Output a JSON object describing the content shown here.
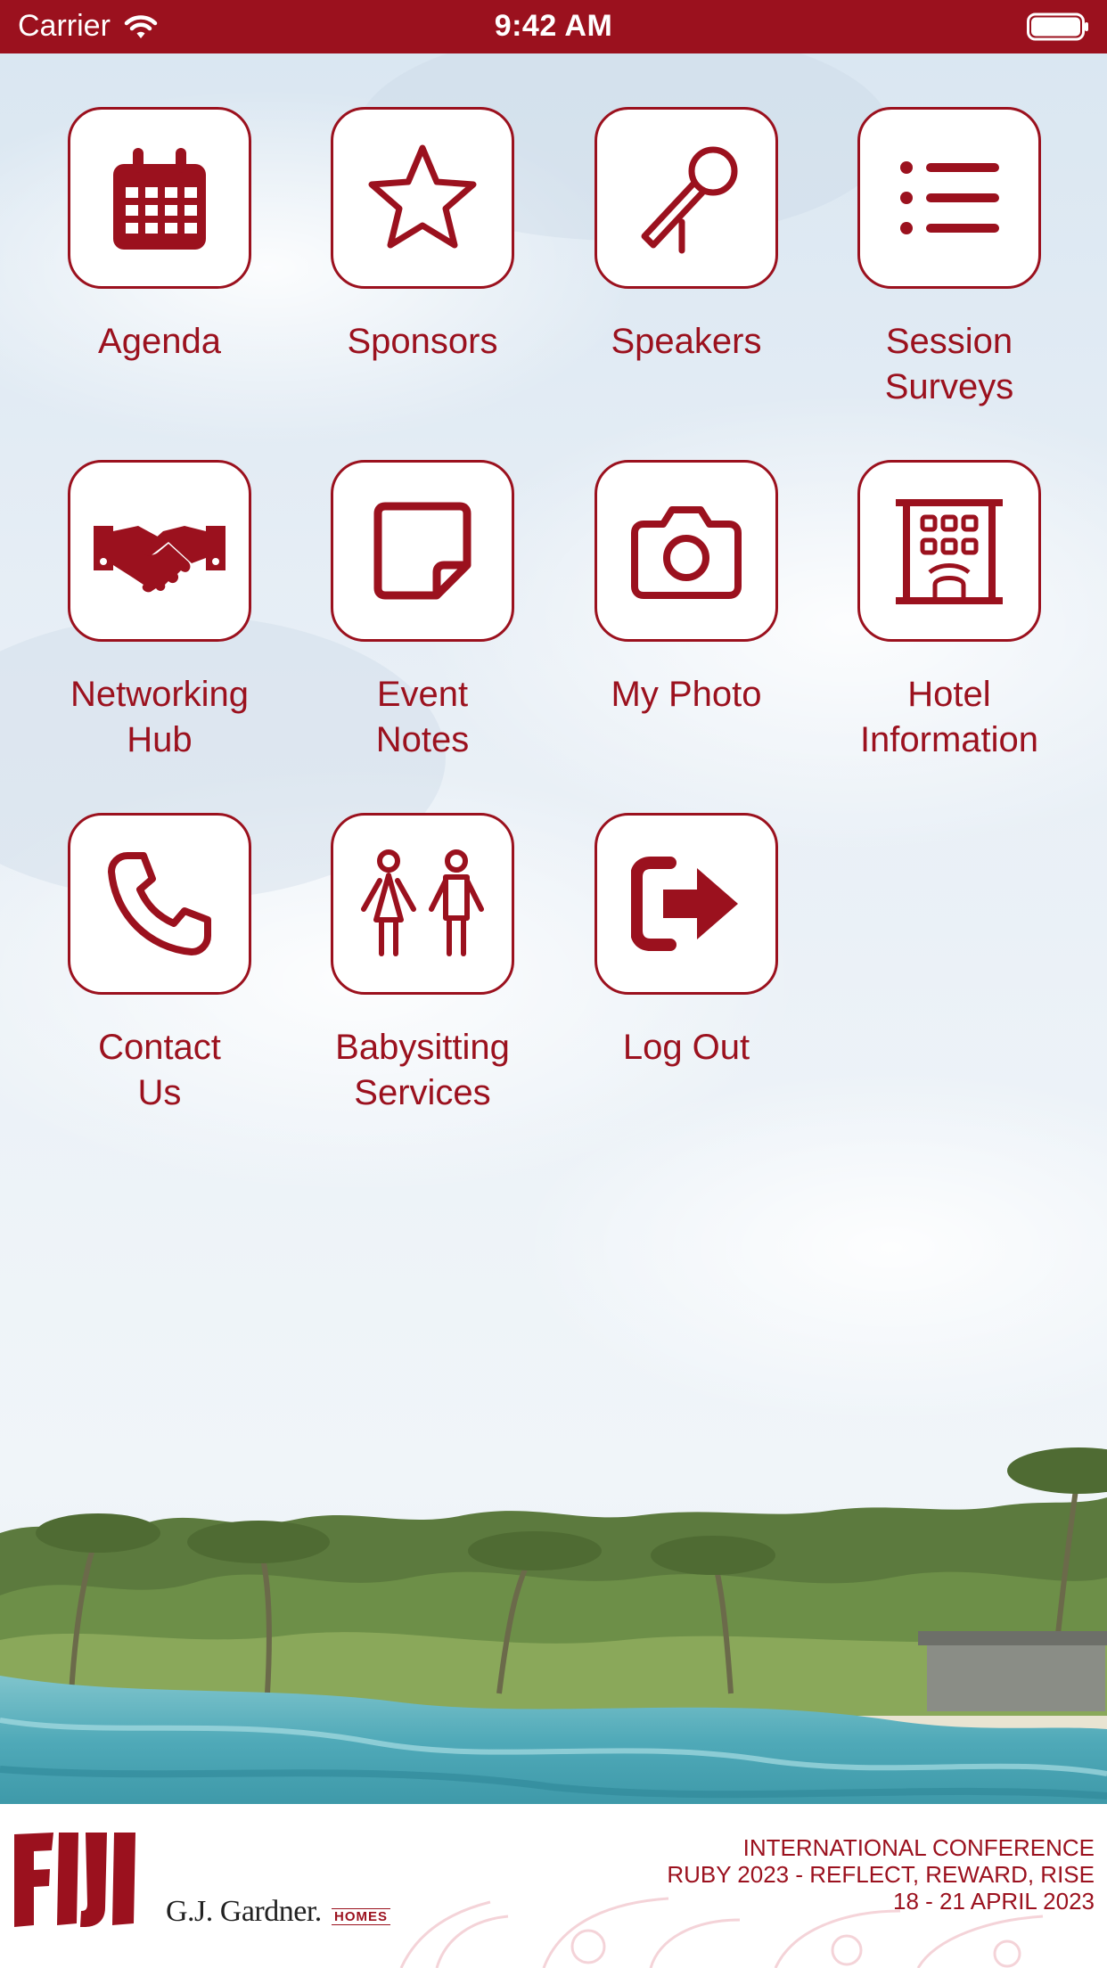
{
  "status_bar": {
    "carrier": "Carrier",
    "time": "9:42 AM"
  },
  "colors": {
    "accent": "#9b111e",
    "tile_bg": "#ffffff"
  },
  "menu": {
    "items": [
      {
        "label": "Agenda",
        "icon": "calendar-icon"
      },
      {
        "label": "Sponsors",
        "icon": "star-icon"
      },
      {
        "label": "Speakers",
        "icon": "microphone-icon"
      },
      {
        "label": "Session\nSurveys",
        "icon": "list-icon"
      },
      {
        "label": "Networking\nHub",
        "icon": "handshake-icon"
      },
      {
        "label": "Event\nNotes",
        "icon": "sticky-note-icon"
      },
      {
        "label": "My Photo",
        "icon": "camera-icon"
      },
      {
        "label": "Hotel\nInformation",
        "icon": "hotel-building-icon"
      },
      {
        "label": "Contact\nUs",
        "icon": "phone-icon"
      },
      {
        "label": "Babysitting\nServices",
        "icon": "children-icon"
      },
      {
        "label": "Log Out",
        "icon": "logout-icon"
      }
    ]
  },
  "footer": {
    "logo_text": "FIJI",
    "brand": "G.J. Gardner.",
    "brand_sub": "HOMES",
    "conference_line1": "INTERNATIONAL CONFERENCE",
    "conference_line2": "RUBY 2023 - REFLECT, REWARD, RISE",
    "conference_line3": "18 - 21 APRIL 2023"
  }
}
